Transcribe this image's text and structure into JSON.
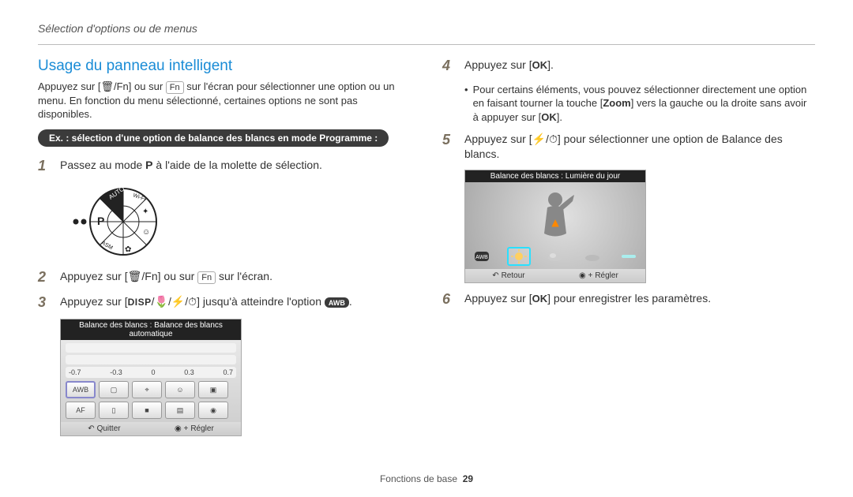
{
  "header": "Sélection d'options ou de menus",
  "left": {
    "title": "Usage du panneau intelligent",
    "intro_pre": "Appuyez sur [",
    "intro_trash_fn": "🗑/Fn",
    "intro_mid": "] ou sur ",
    "intro_fn_btn": "Fn",
    "intro_post": " sur l'écran pour sélectionner une option ou un menu. En fonction du menu sélectionné, certaines options ne sont pas disponibles.",
    "example": "Ex. : sélection d'une option de balance des blancs en mode Programme :",
    "step1_pre": "Passez au mode ",
    "step1_mode": "P",
    "step1_post": " à l'aide de la molette de sélection.",
    "step2_pre": "Appuyez sur [",
    "step2_trash_fn": "🗑/Fn",
    "step2_mid": "] ou sur ",
    "step2_fn_btn": "Fn",
    "step2_post": " sur l'écran.",
    "step3_pre": "Appuyez sur [",
    "step3_disp": "DISP",
    "step3_sep1": "/",
    "step3_flower": "🌷",
    "step3_sep2": "/",
    "step3_flash": "⚡",
    "step3_sep3": "/",
    "step3_timer": "⏱",
    "step3_mid": "] jusqu'à atteindre l'option ",
    "step3_awb": "AWB",
    "panel_title": "Balance des blancs : Balance des blancs automatique",
    "ev_m07": "-0.7",
    "ev_m03": "-0.3",
    "ev_0": "0",
    "ev_p03": "0.3",
    "ev_p07": "0.7",
    "panel_quit": "Quitter",
    "panel_set": "Régler"
  },
  "right": {
    "step4_pre": "Appuyez sur [",
    "step4_ok": "OK",
    "step4_post": "].",
    "bullet_pre": "Pour certains éléments, vous pouvez sélectionner directement une option en faisant tourner la touche [",
    "bullet_zoom": "Zoom",
    "bullet_mid": "] vers la gauche ou la droite sans avoir à appuyer sur [",
    "bullet_ok": "OK",
    "bullet_post": "].",
    "step5_pre": "Appuyez sur [",
    "step5_flash": "⚡",
    "step5_sep": "/",
    "step5_timer": "⏱",
    "step5_post": "] pour sélectionner une option de Balance des blancs.",
    "wb_title": "Balance des blancs : Lumière du jour",
    "wb_back": "Retour",
    "wb_set": "Régler",
    "step6_pre": "Appuyez sur [",
    "step6_ok": "OK",
    "step6_post": "] pour enregistrer les paramètres."
  },
  "footer_label": "Fonctions de base",
  "footer_page": "29"
}
